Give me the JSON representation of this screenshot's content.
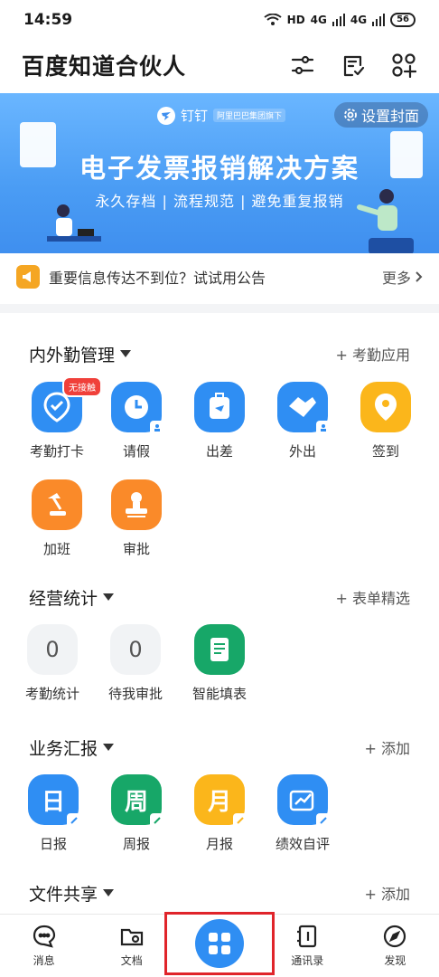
{
  "status": {
    "time": "14:59",
    "network": "HD",
    "signal1": "4G",
    "signal2": "4G",
    "battery": "56"
  },
  "header": {
    "title": "百度知道合伙人"
  },
  "banner": {
    "brand": "钉钉",
    "brand_tag": "阿里巴巴集团旗下",
    "cover_button": "设置封面",
    "title": "电子发票报销解决方案",
    "subtitle": "永久存档 | 流程规范 | 避免重复报销"
  },
  "notice": {
    "text": "重要信息传达不到位？试试用公告",
    "more": "更多"
  },
  "sections": [
    {
      "title": "内外勤管理",
      "action": "+ 考勤应用",
      "apps": [
        {
          "label": "考勤打卡",
          "badge": "无接触"
        },
        {
          "label": "请假"
        },
        {
          "label": "出差"
        },
        {
          "label": "外出"
        },
        {
          "label": "签到"
        },
        {
          "label": "加班"
        },
        {
          "label": "审批"
        }
      ]
    },
    {
      "title": "经营统计",
      "action": "+ 表单精选",
      "apps": [
        {
          "label": "考勤统计",
          "count": "0"
        },
        {
          "label": "待我审批",
          "count": "0"
        },
        {
          "label": "智能填表"
        }
      ]
    },
    {
      "title": "业务汇报",
      "action": "+ 添加",
      "apps": [
        {
          "label": "日报",
          "glyph": "日"
        },
        {
          "label": "周报",
          "glyph": "周"
        },
        {
          "label": "月报",
          "glyph": "月"
        },
        {
          "label": "绩效自评"
        }
      ]
    },
    {
      "title": "文件共享",
      "action": "+ 添加"
    }
  ],
  "nav": [
    {
      "label": "消息",
      "icon": "message-icon"
    },
    {
      "label": "文档",
      "icon": "folder-icon"
    },
    {
      "label": "",
      "icon": "workbench-icon"
    },
    {
      "label": "通讯录",
      "icon": "contacts-icon"
    },
    {
      "label": "发现",
      "icon": "compass-icon"
    }
  ],
  "colors": {
    "accent": "#2f8ef3",
    "orange": "#fa8a29",
    "green": "#17a768",
    "yellow": "#fbb61b",
    "highlight": "#e0242a"
  }
}
